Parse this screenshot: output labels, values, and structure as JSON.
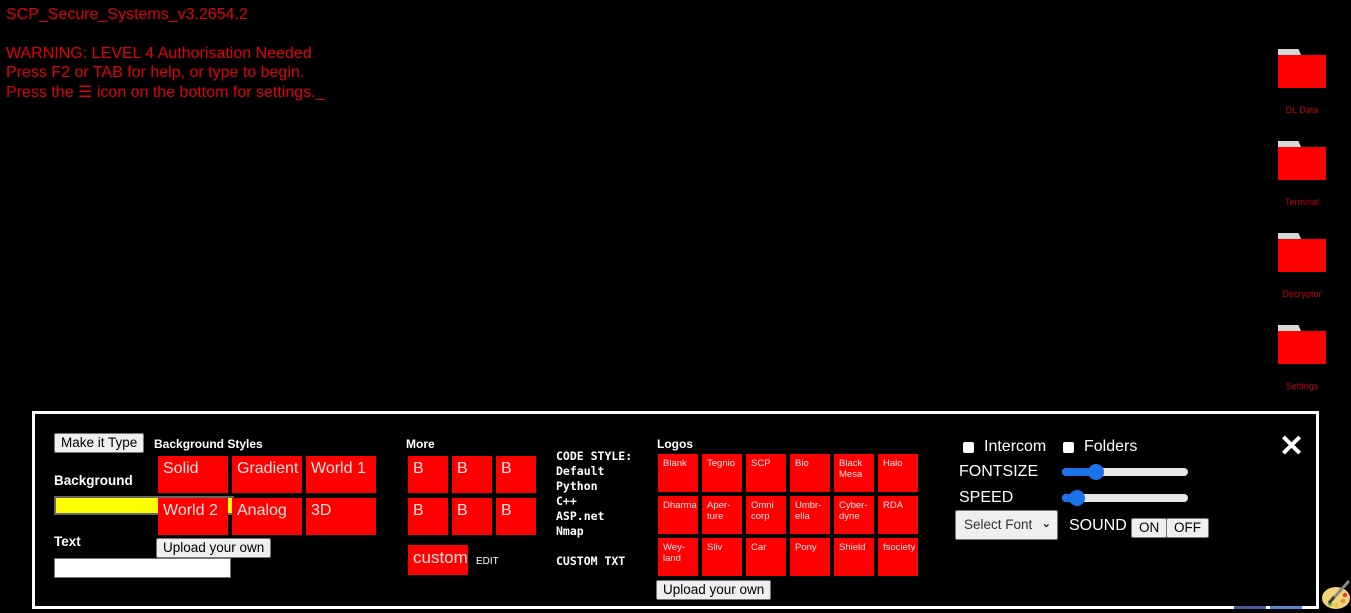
{
  "terminal": {
    "title": "SCP_Secure_Systems_v3.2654.2",
    "lines": [
      "WARNING: LEVEL 4 Authorisation Needed",
      "Press F2 or TAB for help, or type to begin.",
      "Press the ☰ icon on the bottom for settings._"
    ]
  },
  "desktop_folders": [
    {
      "label": "DL Data",
      "icon": "folder-icon"
    },
    {
      "label": "Terminal",
      "icon": "folder-icon"
    },
    {
      "label": "Decryptor",
      "icon": "folder-icon"
    },
    {
      "label": "Settings",
      "icon": "folder-icon"
    }
  ],
  "settings": {
    "make_it_type": "Make it Type",
    "background_label": "Background",
    "background_color": "#ffff00",
    "text_label": "Text",
    "text_value": "",
    "background_styles": {
      "heading": "Background Styles",
      "options": [
        "Solid",
        "Gradient",
        "World 1",
        "World 2",
        "Analog",
        "3D"
      ],
      "upload": "Upload your own"
    },
    "more": {
      "heading": "More",
      "options": [
        "B",
        "B",
        "B",
        "B",
        "B",
        "B"
      ],
      "custom": "custom",
      "edit": "EDIT"
    },
    "code_style": {
      "heading": "CODE STYLE:",
      "options": [
        "Default",
        "Python",
        "C++",
        "ASP.net",
        "Nmap"
      ],
      "custom_txt": "CUSTOM TXT"
    },
    "logos": {
      "heading": "Logos",
      "options": [
        "Blank",
        "Tegnio",
        "SCP",
        "Bio",
        "Black Mesa",
        "Halo",
        "Dharma",
        "Aper-ture",
        "Omni corp",
        "Umbr-ella",
        "Cyber-dyne",
        "RDA",
        "Wey-land",
        "Sliv",
        "Car",
        "Pony",
        "Shield",
        "fsociety"
      ],
      "upload": "Upload your own"
    },
    "intercom_label": "Intercom",
    "intercom_checked": false,
    "folders_label": "Folders",
    "folders_checked": false,
    "fontsize_label": "FONTSIZE",
    "fontsize_value_pct": 27,
    "speed_label": "SPEED",
    "speed_value_pct": 12,
    "font_select": "Select Font",
    "sound_label": "SOUND",
    "sound_on": "ON",
    "sound_off": "OFF",
    "close_icon": "close-icon"
  },
  "colors": {
    "accent_red": "#ff0000",
    "terminal_text": "#e0000a",
    "slider_blue": "#1a73e8"
  }
}
